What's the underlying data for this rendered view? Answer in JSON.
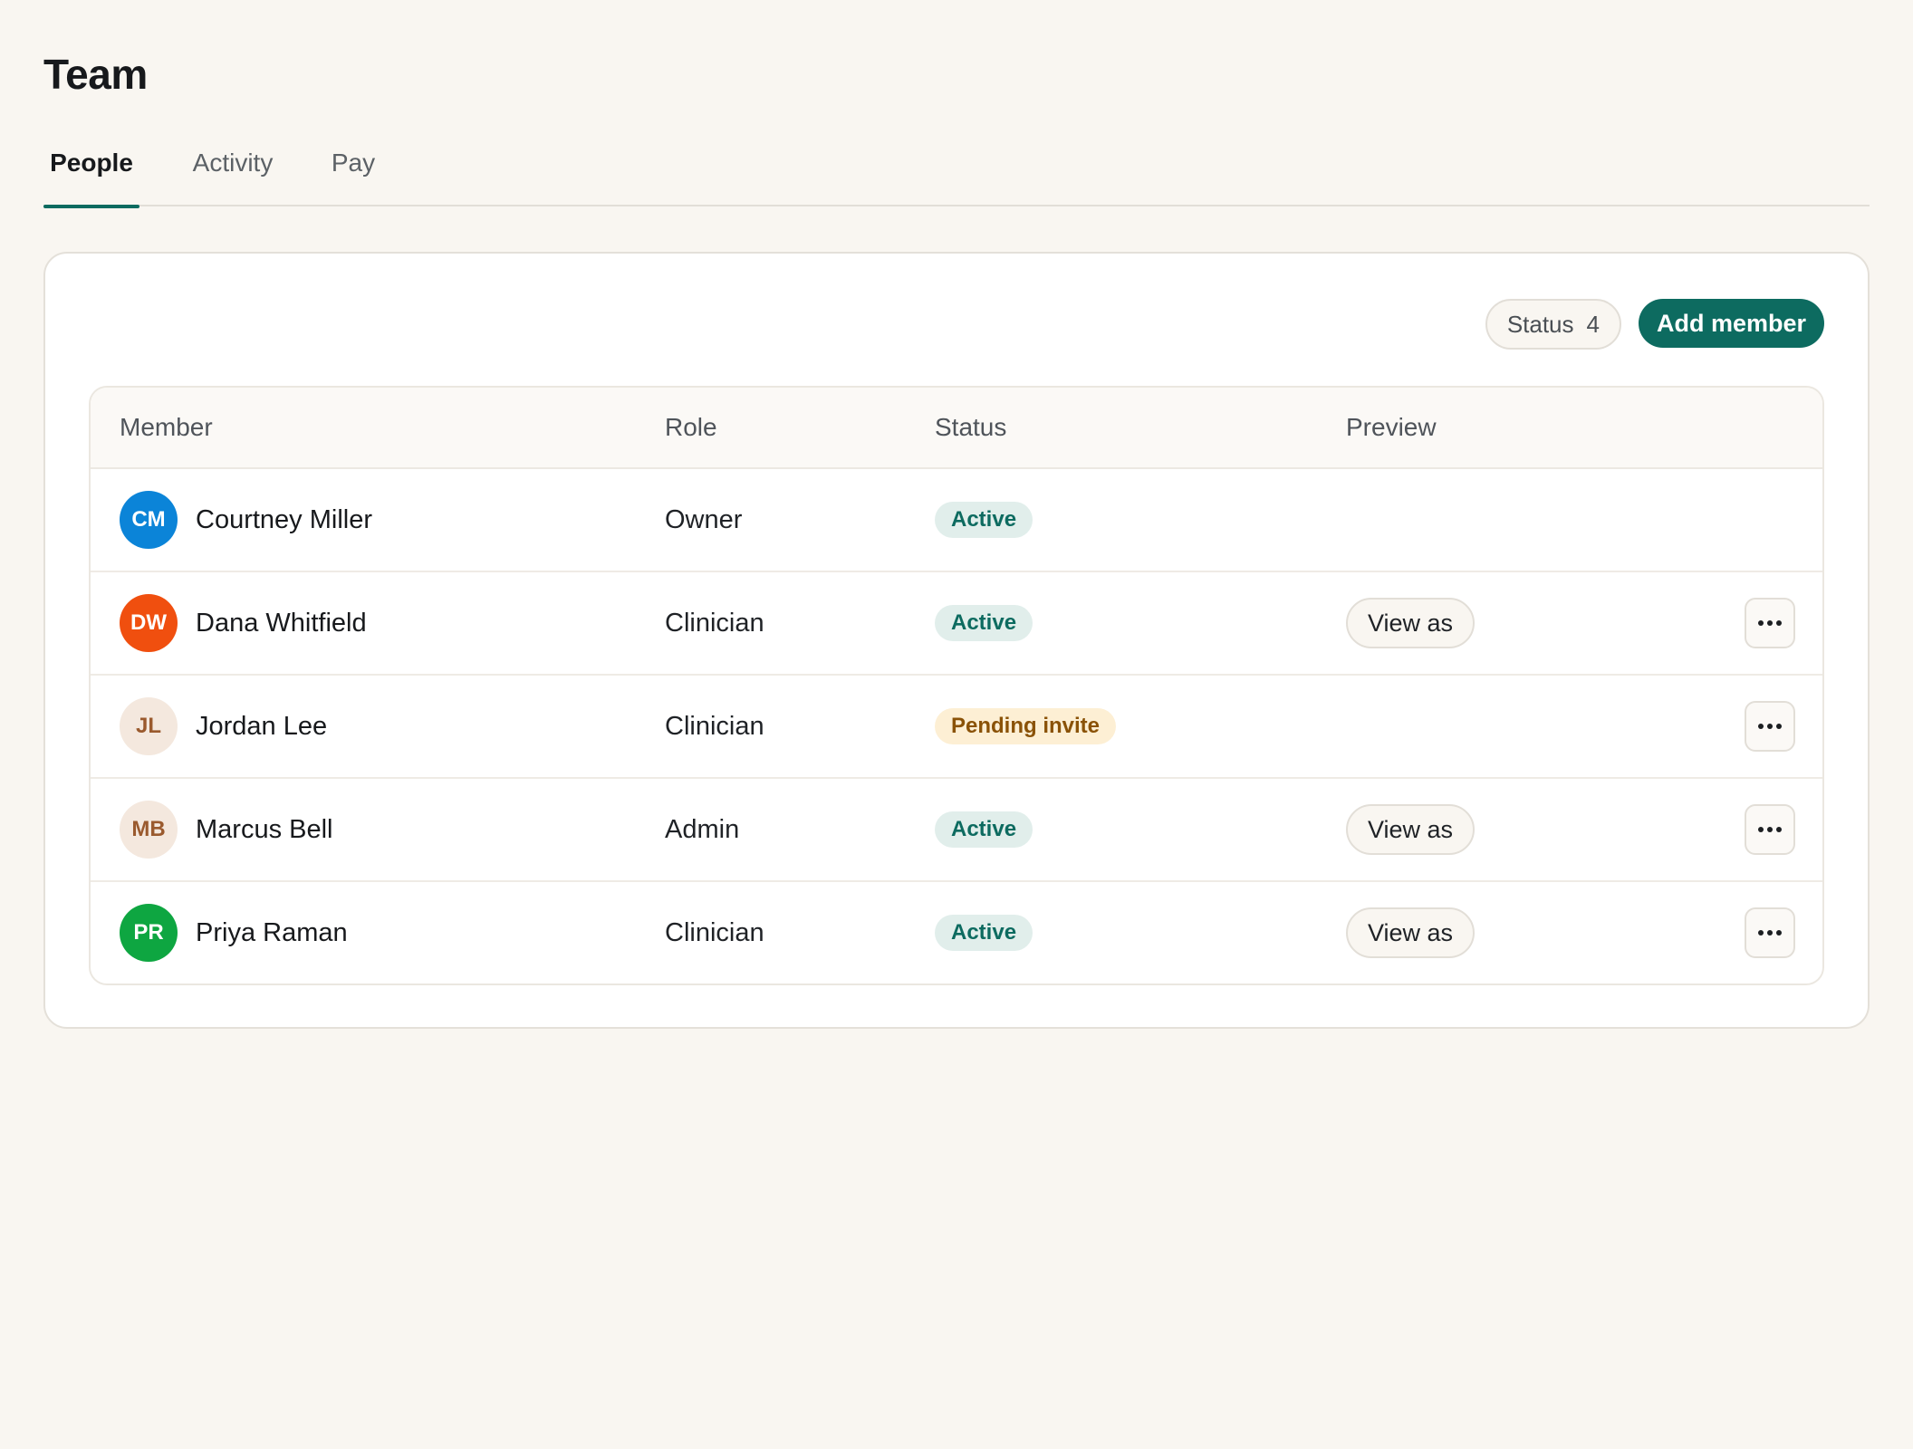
{
  "page": {
    "title": "Team"
  },
  "tabs": [
    {
      "label": "People",
      "active": true
    },
    {
      "label": "Activity",
      "active": false
    },
    {
      "label": "Pay",
      "active": false
    }
  ],
  "toolbar": {
    "status_filter_label": "Status",
    "status_filter_count": "4",
    "add_member_label": "Add member"
  },
  "table": {
    "columns": {
      "member": "Member",
      "role": "Role",
      "status": "Status",
      "preview": "Preview"
    },
    "rows": [
      {
        "initials": "CM",
        "name": "Courtney Miller",
        "role": "Owner",
        "status": "Active",
        "status_kind": "active",
        "avatar_bg": "#0b84d8",
        "avatar_fg": "#ffffff",
        "preview_label": "",
        "has_menu": false
      },
      {
        "initials": "DW",
        "name": "Dana Whitfield",
        "role": "Clinician",
        "status": "Active",
        "status_kind": "active",
        "avatar_bg": "#f04f0f",
        "avatar_fg": "#ffffff",
        "preview_label": "View as",
        "has_menu": true
      },
      {
        "initials": "JL",
        "name": "Jordan Lee",
        "role": "Clinician",
        "status": "Pending invite",
        "status_kind": "pending",
        "avatar_bg": "#f4e8de",
        "avatar_fg": "#9a5a2e",
        "preview_label": "",
        "has_menu": true
      },
      {
        "initials": "MB",
        "name": "Marcus Bell",
        "role": "Admin",
        "status": "Active",
        "status_kind": "active",
        "avatar_bg": "#f4e8de",
        "avatar_fg": "#9a5a2e",
        "preview_label": "View as",
        "has_menu": true
      },
      {
        "initials": "PR",
        "name": "Priya Raman",
        "role": "Clinician",
        "status": "Active",
        "status_kind": "active",
        "avatar_bg": "#0ea641",
        "avatar_fg": "#ffffff",
        "preview_label": "View as",
        "has_menu": true
      }
    ]
  },
  "icons": {
    "row_menu": "more-horizontal-icon"
  },
  "colors": {
    "accent": "#0d6b60",
    "background": "#f9f6f1",
    "active_badge_bg": "#e1eeeb",
    "pending_badge_bg": "#fdefd4",
    "pending_badge_text": "#8a5207"
  }
}
